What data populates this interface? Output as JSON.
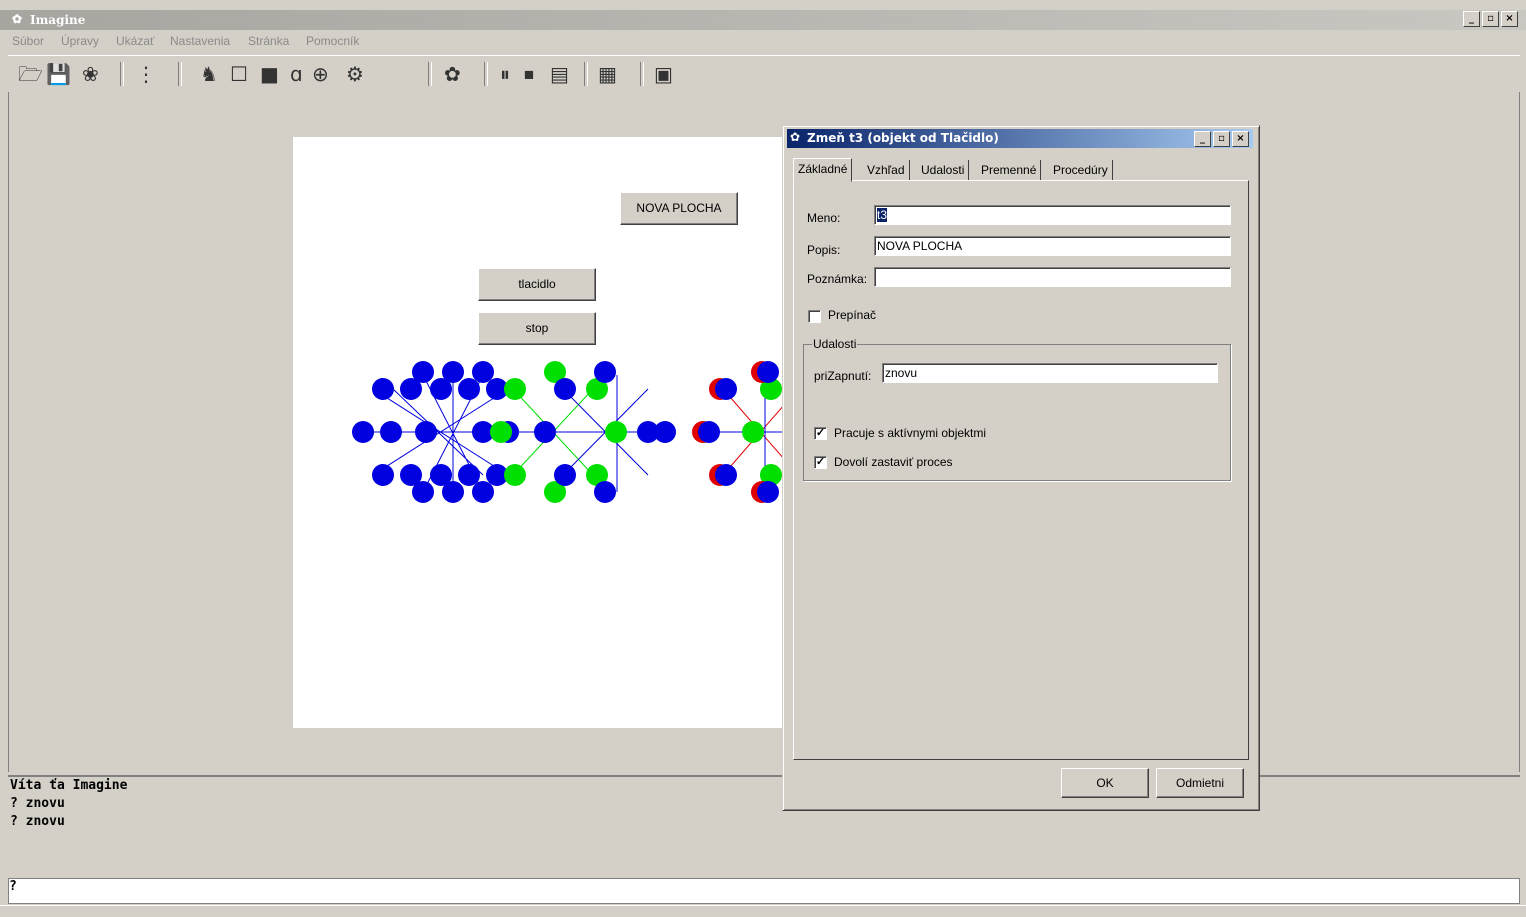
{
  "app": {
    "title": "Imagine"
  },
  "window_buttons": {
    "minimize": "_",
    "maximize": "▫",
    "close": "×"
  },
  "menu": [
    "Súbor",
    "Úpravy",
    "Ukázať",
    "Nastavenia",
    "Stránka",
    "Pomocník"
  ],
  "toolbar": {
    "icons": [
      "open-icon",
      "save-icon",
      "turtle-icon",
      "tree-icon",
      "turtle-new-icon",
      "button-icon",
      "panel-icon",
      "text-icon",
      "slider-icon",
      "tool-icon",
      "imagine-icon",
      "pause-icon",
      "stop-icon",
      "run-icon",
      "page-icon",
      "window-icon"
    ]
  },
  "canvas": {
    "buttons": {
      "nova_plocha": "NOVA PLOCHA",
      "tlacidlo": "tlacidlo",
      "stop": "stop"
    },
    "colors": {
      "blue": "#0000e0",
      "green": "#00e000",
      "red": "#e00000"
    }
  },
  "console": {
    "lines": [
      "Víta ťa Imagine",
      "? znovu",
      "? znovu"
    ]
  },
  "command_line": {
    "prompt": "?"
  },
  "dialog": {
    "title": "Zmeň t3 (objekt od Tlačidlo)",
    "tabs": [
      "Základné",
      "Vzhľad",
      "Udalosti",
      "Premenné",
      "Procedúry"
    ],
    "fields": {
      "meno_label": "Meno:",
      "meno_value": "t3",
      "popis_label": "Popis:",
      "popis_value": "NOVA PLOCHA",
      "poznamka_label": "Poznámka:",
      "poznamka_value": ""
    },
    "prepinac": {
      "label": "Prepínač",
      "checked": false
    },
    "udalosti": {
      "title": "Udalosti",
      "prizapnuti_label": "priZapnutí:",
      "prizapnuti_value": "znovu",
      "pracuje_label": "Pracuje s aktívnymi objektmi",
      "pracuje_checked": true,
      "dovoli_label": "Dovolí zastaviť proces",
      "dovoli_checked": true
    },
    "ok": "OK",
    "cancel": "Odmietni"
  }
}
